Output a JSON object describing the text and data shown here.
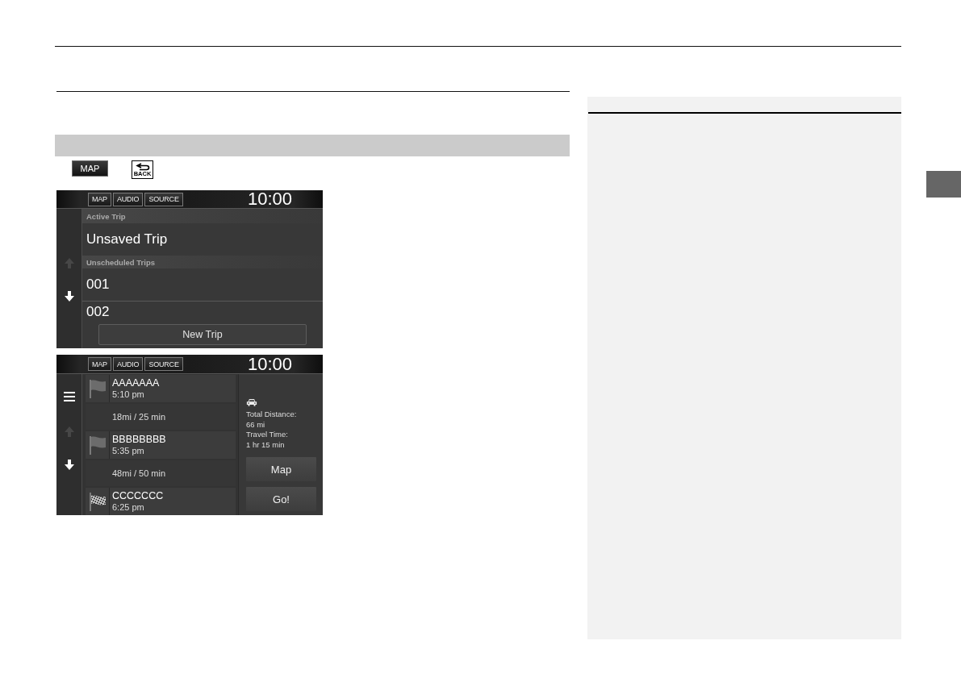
{
  "key_icons": [
    {
      "kind": "map",
      "label": "MAP"
    },
    {
      "kind": "back",
      "label": "BACK"
    }
  ],
  "screens": [
    {
      "kind": "trips",
      "status_bar": {
        "buttons": [
          "MAP",
          "AUDIO",
          "SOURCE"
        ],
        "clock": "10:00"
      },
      "scroll_buttons": [
        {
          "kind": "up",
          "disabled": true
        },
        {
          "kind": "down",
          "disabled": false
        }
      ],
      "sections": [
        {
          "heading": "Active Trip",
          "items": [
            "Unsaved Trip"
          ]
        },
        {
          "heading": "Unscheduled Trips",
          "items": [
            "001",
            "002"
          ]
        }
      ],
      "action_button": "New Trip"
    },
    {
      "kind": "itinerary",
      "status_bar": {
        "buttons": [
          "MAP",
          "AUDIO",
          "SOURCE"
        ],
        "clock": "10:00"
      },
      "scroll_buttons": [
        {
          "kind": "up",
          "disabled": true
        },
        {
          "kind": "down",
          "disabled": false
        }
      ],
      "stops": [
        {
          "kind": "flag",
          "name": "AAAAAAA",
          "time": "5:10 pm",
          "leg": "18mi / 25 min"
        },
        {
          "kind": "flag",
          "name": "BBBBBBBB",
          "time": "5:35 pm",
          "leg": "48mi / 50 min"
        },
        {
          "kind": "finish",
          "name": "CCCCCCC",
          "time": "6:25 pm"
        }
      ],
      "summary": {
        "distance_label": "Total Distance:",
        "distance": "66 mi",
        "time_label": "Travel Time:",
        "time": "1 hr 15 min"
      },
      "buttons": [
        "Map",
        "Go!"
      ]
    }
  ]
}
